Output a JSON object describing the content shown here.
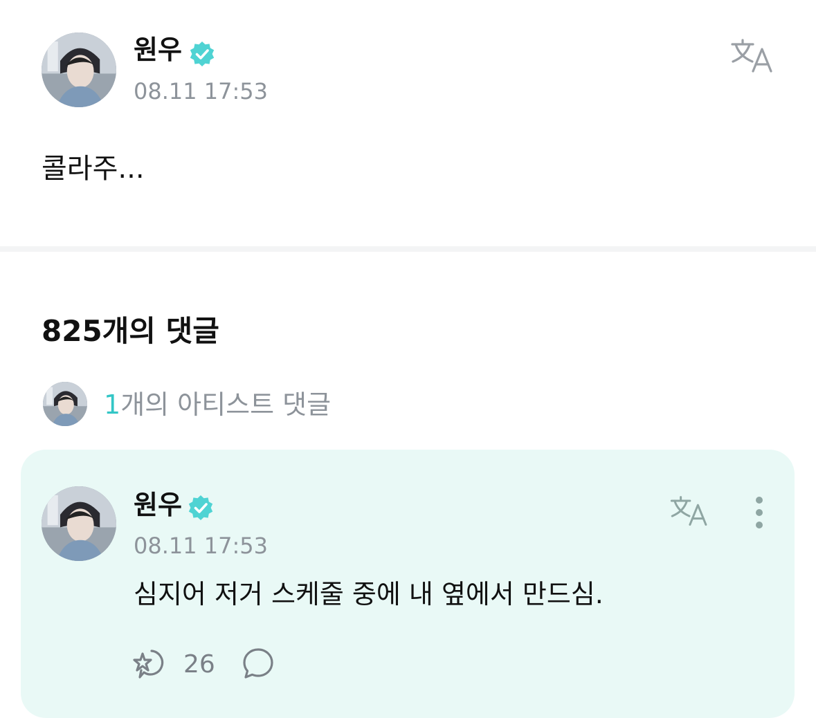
{
  "post": {
    "author": "원우",
    "timestamp": "08.11 17:53",
    "body": "콜라주...",
    "icons": {
      "verified": "verified-badge-icon",
      "translate": "translate-icon"
    }
  },
  "comments_header": {
    "title": "825개의 댓글"
  },
  "artist_comments": {
    "count": "1",
    "label": "개의 아티스트 댓글"
  },
  "comment": {
    "author": "원우",
    "timestamp": "08.11 17:53",
    "text": "심지어 저거 스케줄 중에 내 옆에서 만드심.",
    "like_count": "26",
    "icons": {
      "verified": "verified-badge-icon",
      "translate": "translate-icon",
      "more": "more-vertical-icon",
      "like": "like-icon",
      "reply": "reply-icon"
    }
  },
  "colors": {
    "accent": "#33c6c6",
    "verified": "#4fd3d3",
    "card_background": "#e9f9f6",
    "muted_text": "#8d939a"
  }
}
